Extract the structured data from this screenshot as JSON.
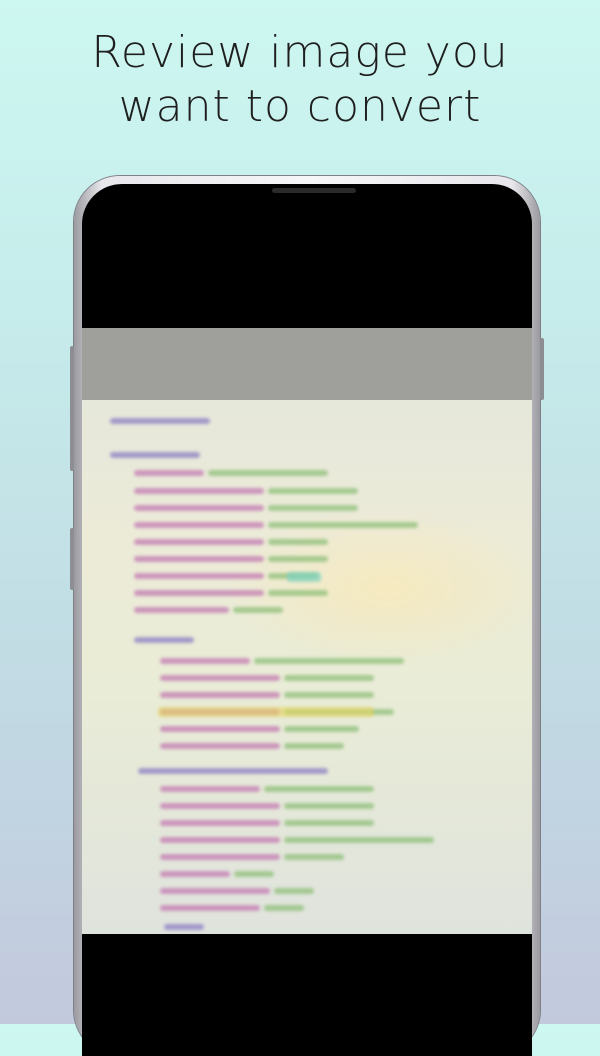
{
  "headline": {
    "line1": "Review image you",
    "line2": "want to convert"
  },
  "colors": {
    "background_top": "#cdf7f1",
    "background_bottom": "#c2c9dd",
    "headline_text": "#1e1e1e",
    "code_tag": "#8d7fc4",
    "code_attr": "#c37bb2",
    "code_value": "#8fbf7a",
    "code_highlight": "#e8d65e"
  },
  "photo": {
    "description_icon": "blurred-code-photo",
    "content_visible": false
  }
}
